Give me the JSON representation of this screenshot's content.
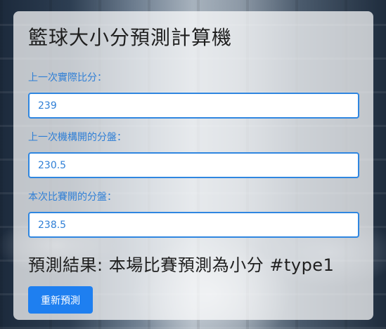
{
  "app": {
    "title": "籃球大小分預測計算機"
  },
  "form": {
    "last_actual_label": "上一次實際比分：",
    "last_actual_value": "239",
    "last_line_label": "上一次機構開的分盤：",
    "last_line_value": "230.5",
    "current_line_label": "本次比賽開的分盤：",
    "current_line_value": "238.5"
  },
  "result": {
    "text": "預測結果: 本場比賽預測為小分 #type1"
  },
  "actions": {
    "reset_label": "重新預測"
  },
  "colors": {
    "accent": "#1e7ff0",
    "label": "#2f7fd6",
    "card_bg": "rgba(255,255,255,0.72)"
  }
}
